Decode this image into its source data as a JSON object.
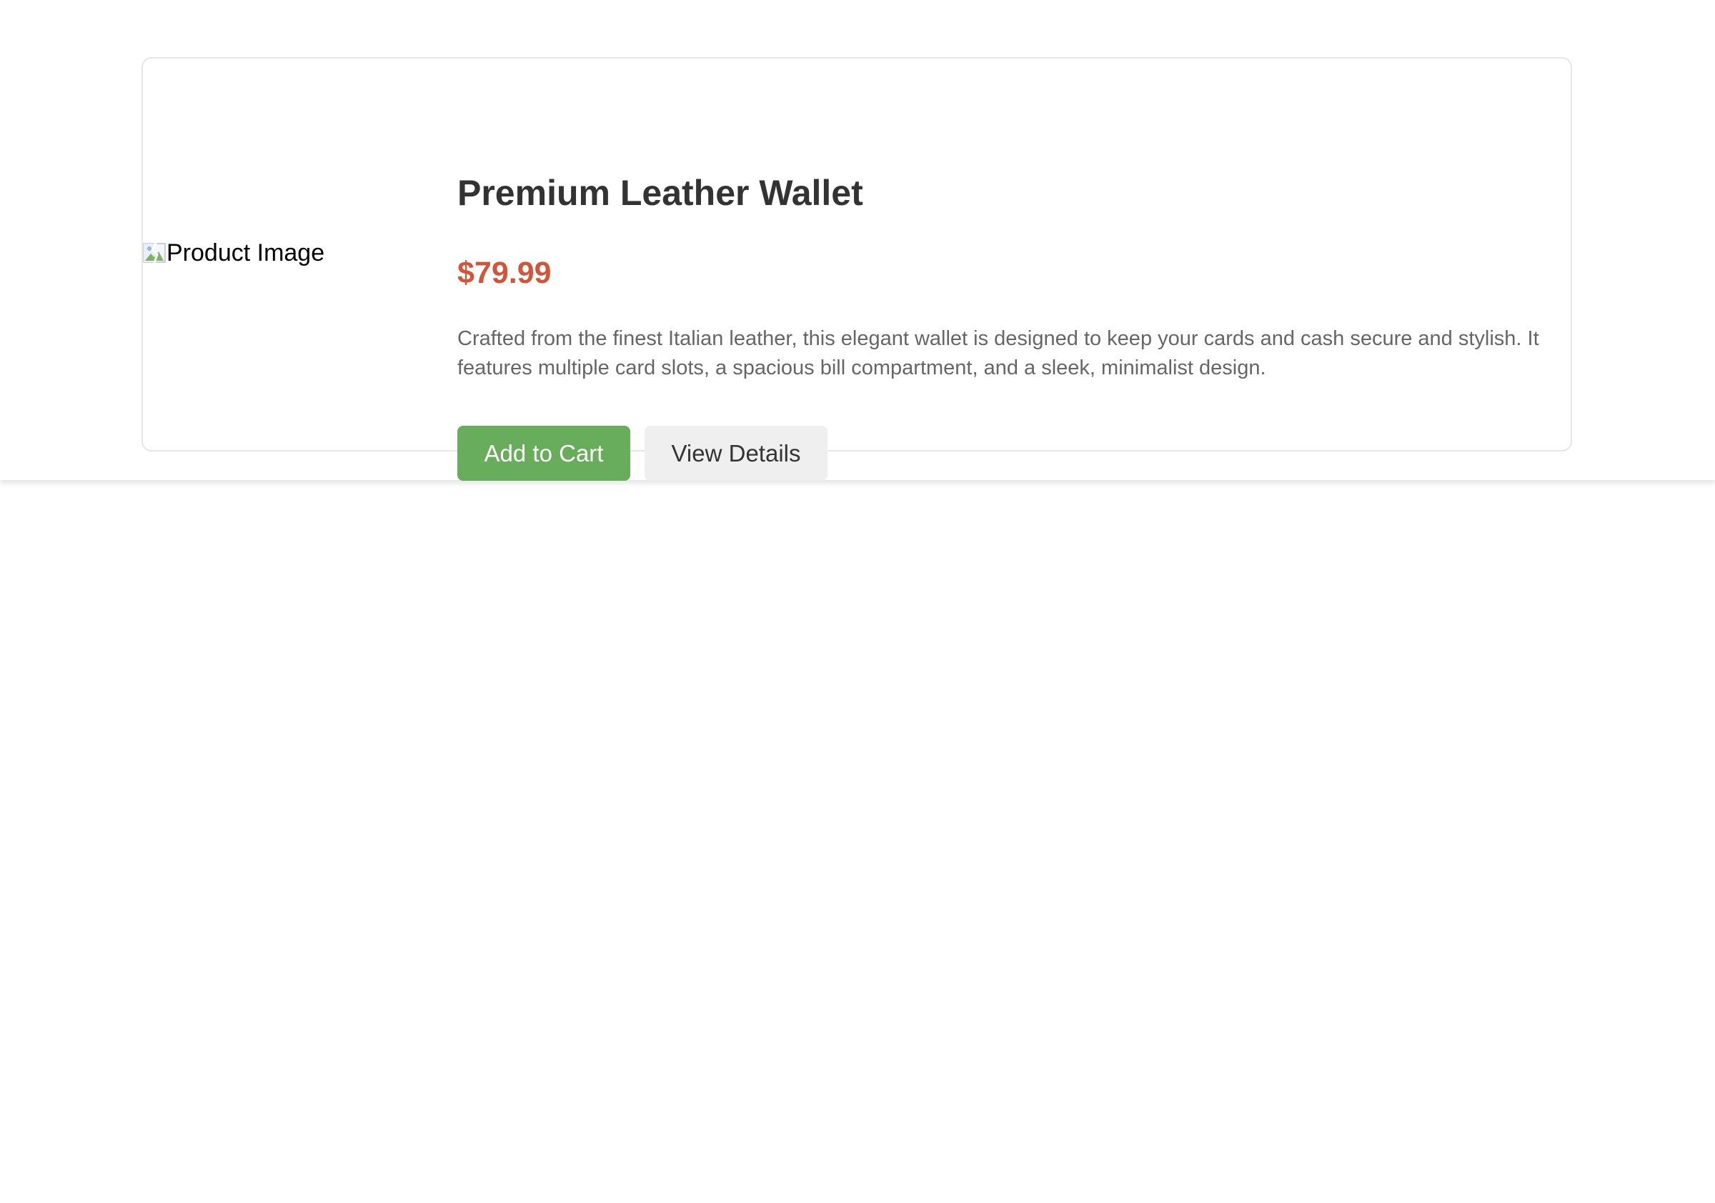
{
  "product": {
    "image_alt": "Product Image",
    "title": "Premium Leather Wallet",
    "price": "$79.99",
    "description": "Crafted from the finest Italian leather, this elegant wallet is designed to keep your cards and cash secure and stylish. It features multiple card slots, a spacious bill compartment, and a sleek, minimalist design."
  },
  "actions": {
    "add_to_cart_label": "Add to Cart",
    "view_details_label": "View Details"
  },
  "colors": {
    "price": "#d2553a",
    "primary_button": "#67ad5b",
    "secondary_button": "#efefef",
    "title": "#333333",
    "description": "#666666"
  },
  "icons": {
    "image_placeholder": "broken-image-icon"
  }
}
